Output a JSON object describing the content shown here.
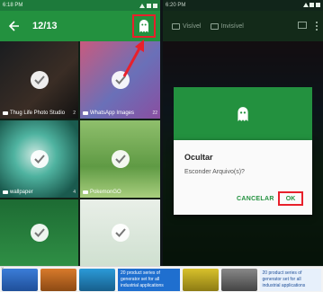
{
  "left": {
    "status_time": "6:18 PM",
    "app_bar": {
      "counter": "12/13"
    },
    "folders": [
      {
        "name": "Thug Life Photo Studio",
        "count": "2",
        "selected": true
      },
      {
        "name": "WhatsApp Images",
        "count": "22",
        "selected": true
      },
      {
        "name": "wallpaper",
        "count": "4",
        "selected": true
      },
      {
        "name": "PokemonGO",
        "count": "",
        "selected": true
      },
      {
        "name": "",
        "count": "",
        "selected": true
      },
      {
        "name": "",
        "count": "",
        "selected": true
      }
    ]
  },
  "right": {
    "status_time": "6:20 PM",
    "tabs": [
      {
        "label": "Visível"
      },
      {
        "label": "Invisível"
      }
    ],
    "dialog": {
      "title": "Ocultar",
      "message": "Esconder Arquivo(s)?",
      "cancel_label": "CANCELAR",
      "ok_label": "OK"
    }
  },
  "ad": {
    "text_1": "20 product series of generator set for all industrial applications",
    "text_2": "20 product series of generator set for all industrial applications"
  },
  "colors": {
    "primary_green": "#23913f",
    "highlight_red": "#e8202b"
  }
}
